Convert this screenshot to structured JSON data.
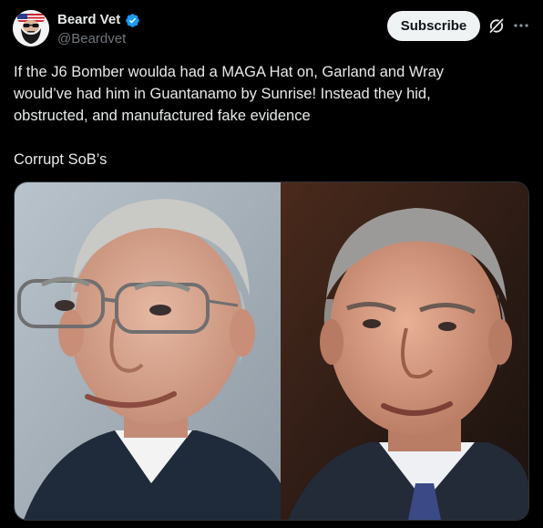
{
  "author": {
    "display_name": "Beard Vet",
    "handle": "@Beardvet",
    "verified": true,
    "avatar_icon": "bearded-face-flag-avatar"
  },
  "actions": {
    "subscribe_label": "Subscribe",
    "grok_icon": "grok-slash-icon",
    "more_icon": "more-dots-icon"
  },
  "tweet": {
    "lines": [
      "If the J6 Bomber woulda had a MAGA Hat on, Garland and Wray",
      "would’ve had him in Guantanamo by Sunrise! Instead they hid,",
      "obstructed, and manufactured fake evidence"
    ],
    "signoff": "Corrupt SoB’s"
  },
  "media": {
    "type": "photo-collage",
    "panels": [
      "left-portrait-photo",
      "right-portrait-photo"
    ]
  },
  "colors": {
    "background": "#000000",
    "text": "#e7e9ea",
    "secondary": "#71767b",
    "verified": "#1d9bf0",
    "button_bg": "#eff3f4"
  }
}
